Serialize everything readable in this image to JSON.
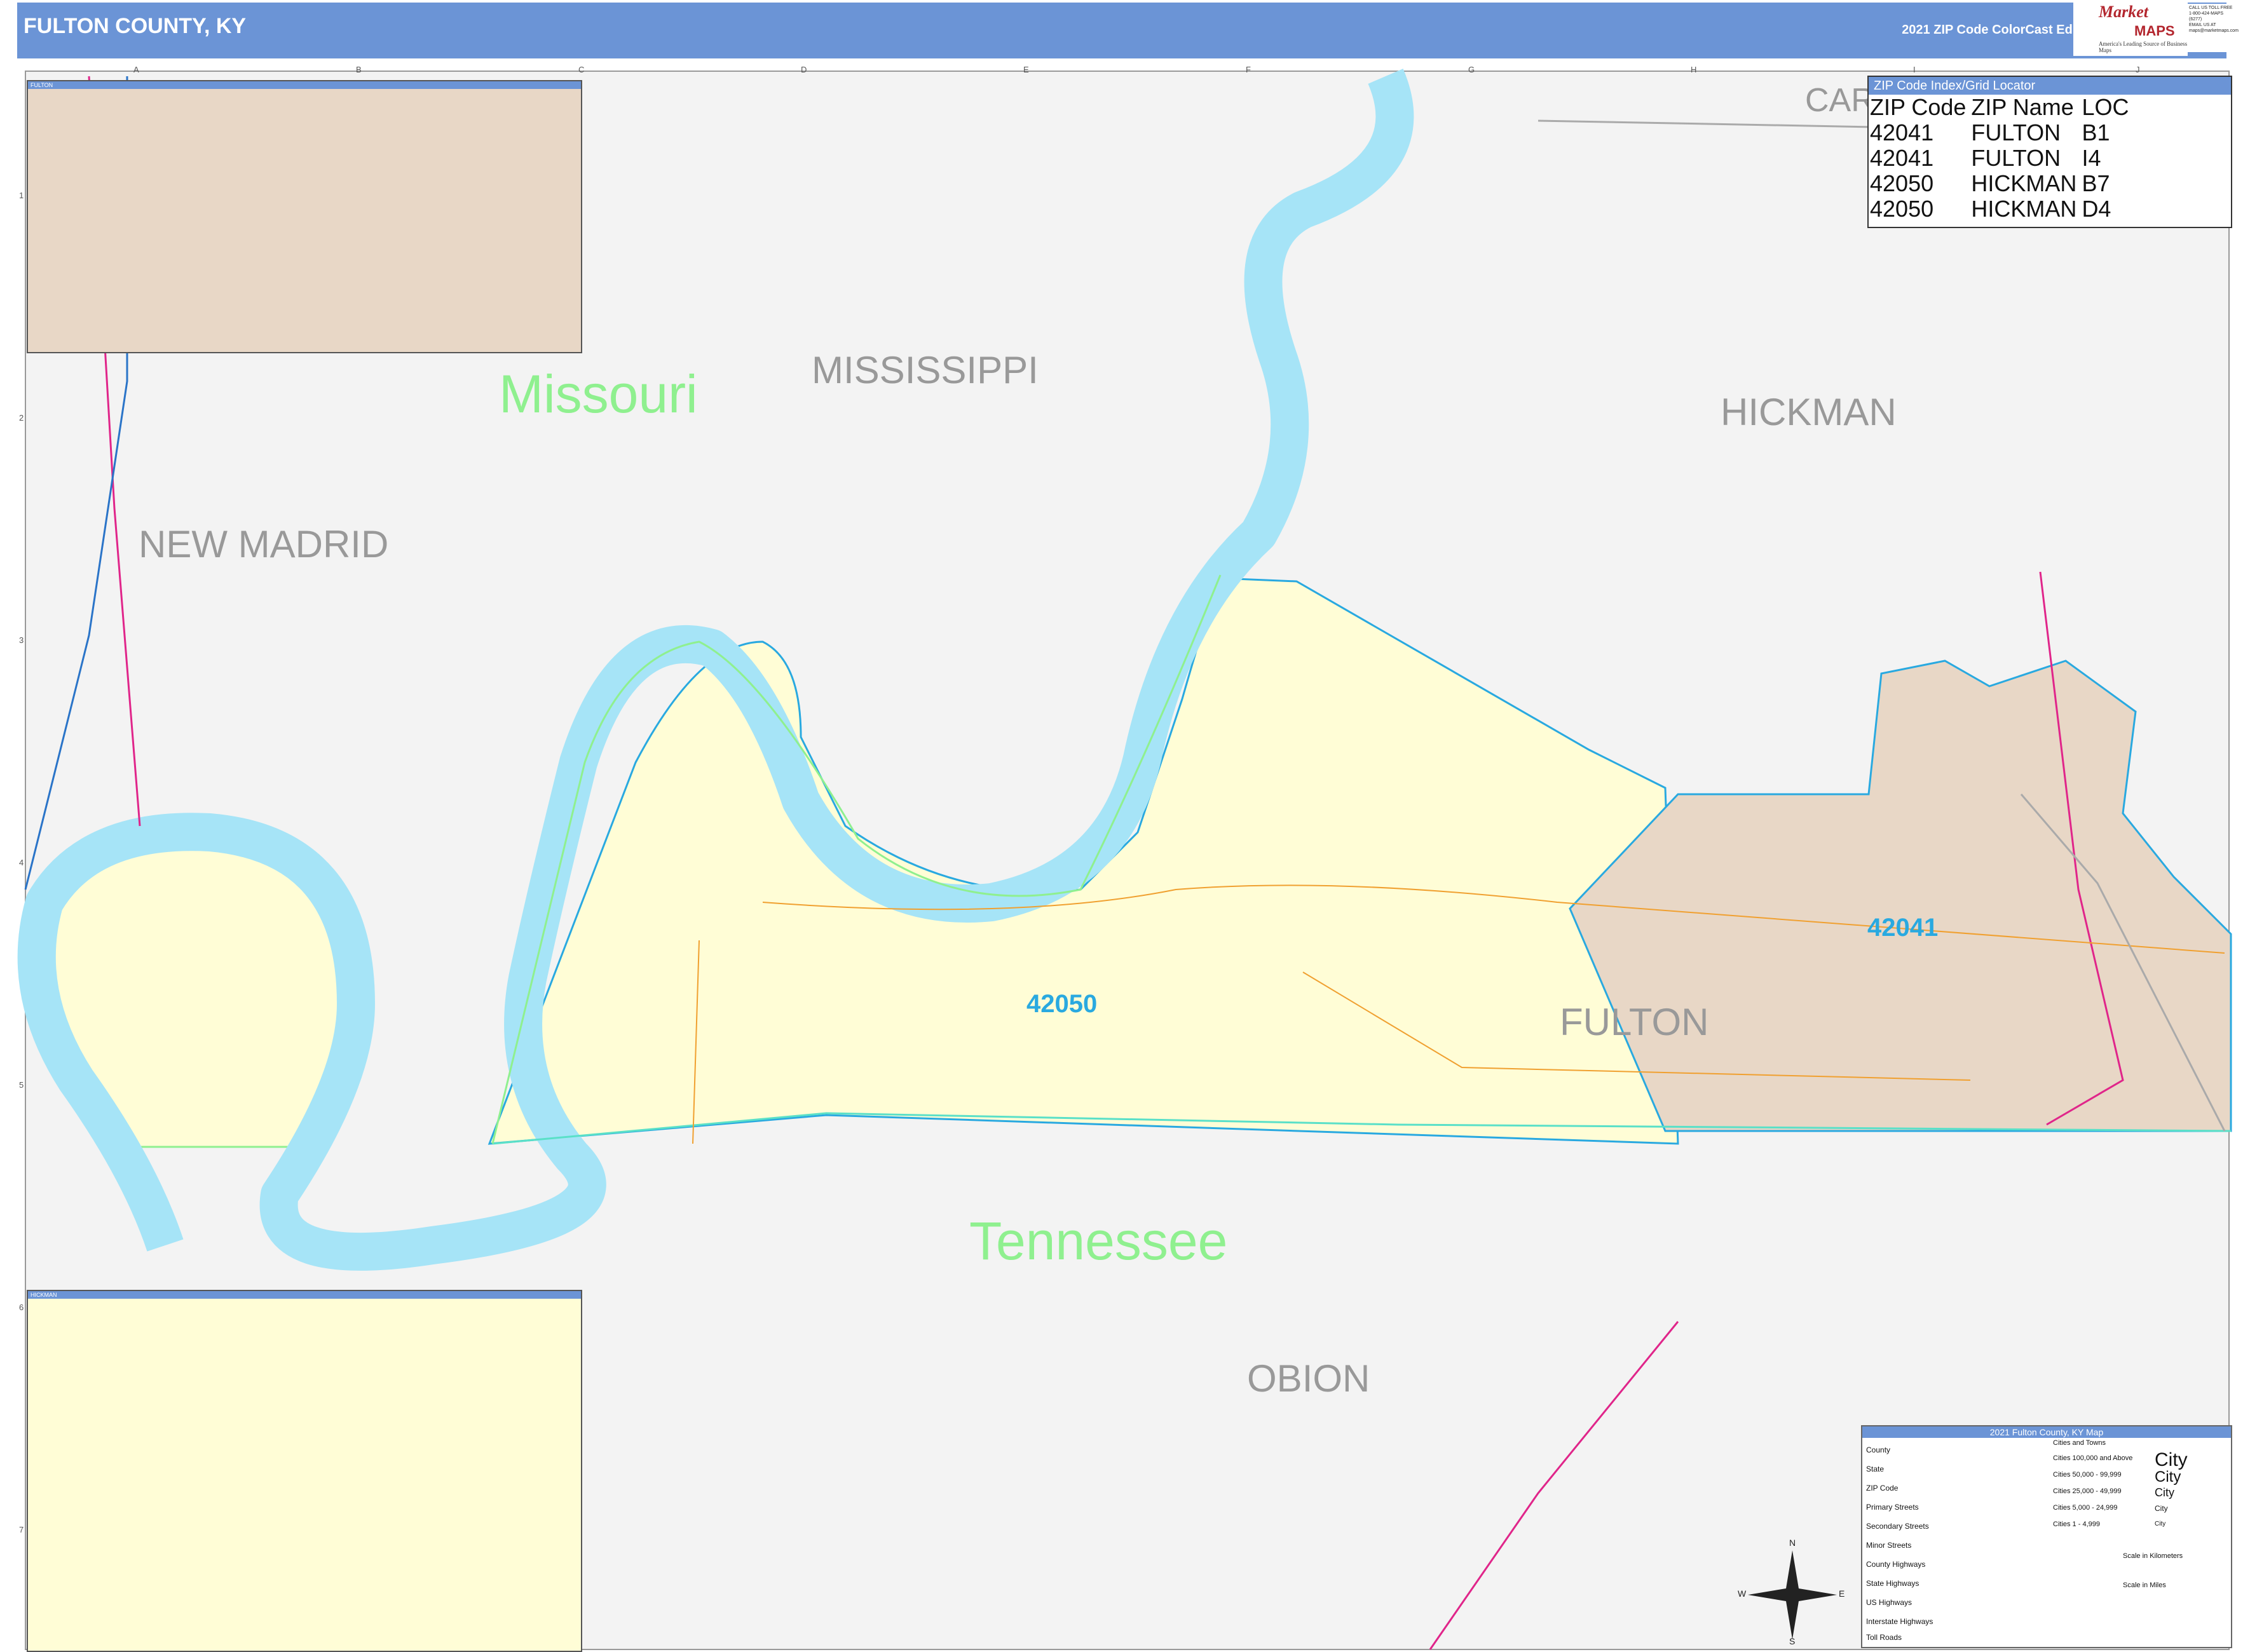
{
  "header": {
    "title": "FULTON COUNTY, KY",
    "edition": "2021 ZIP Code ColorCast Edition"
  },
  "logo": {
    "brand": "Market",
    "maps": "MAPS",
    "tagline": "On Target. On Time.",
    "subtag": "America's Leading Source of Business Maps",
    "contact": [
      "CALL US TOLL FREE",
      "1-800-424-MAPS (6277)",
      "EMAIL US AT",
      "maps@marketmaps.com"
    ]
  },
  "places": {
    "new_madrid": "NEW MADRID",
    "mississippi": "MISSISSIPPI",
    "hickman": "HICKMAN",
    "fulton": "FULTON",
    "obion": "OBION",
    "carlisle_partial": "CAR"
  },
  "states": {
    "missouri": "Missouri",
    "tennessee": "Tennessee"
  },
  "zips": {
    "z42050": "42050",
    "z42041": "42041"
  },
  "zip_index": {
    "heading": "ZIP Code Index/Grid Locator",
    "columns": [
      "ZIP Code",
      "ZIP Name",
      "LOC"
    ],
    "rows": [
      [
        "42041",
        "FULTON",
        "B1"
      ],
      [
        "42041",
        "FULTON",
        "I4"
      ],
      [
        "42050",
        "HICKMAN",
        "B7"
      ],
      [
        "42050",
        "HICKMAN",
        "D4"
      ]
    ]
  },
  "insets": {
    "top_left": "FULTON",
    "bottom_left": "HICKMAN",
    "hickman_marker": "HICKMAN",
    "fulton_marker": "FULTON"
  },
  "legend": {
    "title": "2021 Fulton County, KY Map",
    "items": [
      "County",
      "State",
      "ZIP Code",
      "Primary Streets",
      "Secondary Streets",
      "Minor Streets",
      "County Highways",
      "State Highways",
      "US Highways",
      "Interstate Highways",
      "Toll Roads"
    ],
    "cities_heading": "Cities and Towns",
    "city_classes": [
      "Cities 100,000 and Above",
      "Cities 50,000 - 99,999",
      "Cities 25,000 - 49,999",
      "Cities 5,000 - 24,999",
      "Cities 1 - 4,999"
    ],
    "city_samples": [
      "City",
      "City",
      "City",
      "City",
      "City"
    ],
    "scale_km": "Scale in Kilometers",
    "scale_mi": "Scale in Miles"
  },
  "compass": {
    "n": "N",
    "s": "S",
    "e": "E",
    "w": "W"
  },
  "grid": {
    "columns": [
      "A",
      "B",
      "C",
      "D",
      "E",
      "F",
      "G",
      "H",
      "I",
      "J"
    ],
    "rows": [
      "1",
      "2",
      "3",
      "4",
      "5",
      "6",
      "7"
    ]
  },
  "colors": {
    "header": "#6b94d6",
    "water": "#a6e4f7",
    "zip_42050": "#fffdd6",
    "zip_42041": "#e8d7c6",
    "background": "#f3f3f3",
    "state_line": "#8ff08f",
    "zip_line": "#29a9e0",
    "us_highway": "#e0258a",
    "state_highway": "#f0a030",
    "interstate": "#2a74c8"
  }
}
